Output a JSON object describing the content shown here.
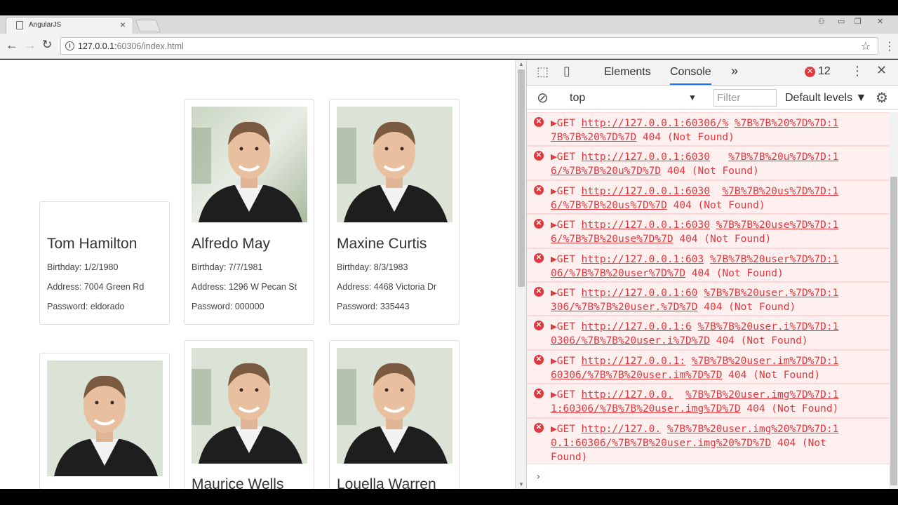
{
  "browser": {
    "tab_title": "AngularJS",
    "url_host": "127.0.0.1:",
    "url_rest": "60306/index.html"
  },
  "cards": [
    {
      "name": "Tom Hamilton",
      "birthday": "Birthday: 1/2/1980",
      "address": "Address: 7004 Green Rd",
      "password": "Password: eldorado"
    },
    {
      "name": "Alfredo May",
      "birthday": "Birthday: 7/7/1981",
      "address": "Address: 1296 W Pecan St",
      "password": "Password: 000000"
    },
    {
      "name": "Maxine Curtis",
      "birthday": "Birthday: 8/3/1983",
      "address": "Address: 4468 Victoria Dr",
      "password": "Password: 335443"
    },
    {
      "name": "",
      "birthday": "",
      "address": "",
      "password": ""
    },
    {
      "name": "Maurice Wells",
      "birthday": "",
      "address": "",
      "password": ""
    },
    {
      "name": "Louella Warren",
      "birthday": "",
      "address": "",
      "password": ""
    }
  ],
  "devtools": {
    "tabs": [
      "Elements",
      "Console"
    ],
    "more": "»",
    "error_count": "12",
    "context": "top",
    "filter_placeholder": "Filter",
    "levels": "Default levels",
    "messages": [
      {
        "l1_pre": "▶GET ",
        "l1_link": "http://127.0.0.1:60306/%",
        "l1_gap": " ",
        "l1_link2": "%7B%7B%20%7D%7D:1",
        "l2_link": "7B%7B%20%7D%7D",
        "l2_post": " 404 (Not Found)",
        "l3": ""
      },
      {
        "l1_pre": "▶GET ",
        "l1_link": "http://127.0.0.1:6030",
        "l1_gap": "   ",
        "l1_link2": "%7B%7B%20u%7D%7D:1",
        "l2_link": "6/%7B%7B%20u%7D%7D",
        "l2_post": " 404 (Not Found)",
        "l3": ""
      },
      {
        "l1_pre": "▶GET ",
        "l1_link": "http://127.0.0.1:6030",
        "l1_gap": "  ",
        "l1_link2": "%7B%7B%20us%7D%7D:1",
        "l2_link": "6/%7B%7B%20us%7D%7D",
        "l2_post": " 404 (Not Found)",
        "l3": ""
      },
      {
        "l1_pre": "▶GET ",
        "l1_link": "http://127.0.0.1:6030",
        "l1_gap": " ",
        "l1_link2": "%7B%7B%20use%7D%7D:1",
        "l2_link": "6/%7B%7B%20use%7D%7D",
        "l2_post": " 404 (Not Found)",
        "l3": ""
      },
      {
        "l1_pre": "▶GET ",
        "l1_link": "http://127.0.0.1:603",
        "l1_gap": " ",
        "l1_link2": "%7B%7B%20user%7D%7D:1",
        "l2_link": "06/%7B%7B%20user%7D%7D",
        "l2_post": " 404 (Not Found)",
        "l3": ""
      },
      {
        "l1_pre": "▶GET ",
        "l1_link": "http://127.0.0.1:60",
        "l1_gap": " ",
        "l1_link2": "%7B%7B%20user.%7D%7D:1",
        "l2_link": "306/%7B%7B%20user.%7D%7D",
        "l2_post": " 404 (Not Found)",
        "l3": ""
      },
      {
        "l1_pre": "▶GET ",
        "l1_link": "http://127.0.0.1:6",
        "l1_gap": " ",
        "l1_link2": "%7B%7B%20user.i%7D%7D:1",
        "l2_link": "0306/%7B%7B%20user.i%7D%7D",
        "l2_post": " 404 (Not Found)",
        "l3": ""
      },
      {
        "l1_pre": "▶GET ",
        "l1_link": "http://127.0.0.1:",
        "l1_gap": " ",
        "l1_link2": "%7B%7B%20user.im%7D%7D:1",
        "l2_link": "60306/%7B%7B%20user.im%7D%7D",
        "l2_post": " 404 (Not Found)",
        "l3": ""
      },
      {
        "l1_pre": "▶GET ",
        "l1_link": "http://127.0.0.",
        "l1_gap": "  ",
        "l1_link2": "%7B%7B%20user.img%7D%7D:1",
        "l2_link": "1:60306/%7B%7B%20user.img%7D%7D",
        "l2_post": " 404 (Not Found)",
        "l3": ""
      },
      {
        "l1_pre": "▶GET ",
        "l1_link": "http://127.0.",
        "l1_gap": " ",
        "l1_link2": "%7B%7B%20user.img%20%7D%7D:1",
        "l2_link": "0.1:60306/%7B%7B%20user.img%20%7D%7D",
        "l2_post": " 404 (Not",
        "l3": "Found)"
      }
    ],
    "prompt": "›"
  },
  "colors": {
    "error": "#e0383e",
    "error_bg": "#fff0f0",
    "accent": "#1a73e8"
  }
}
